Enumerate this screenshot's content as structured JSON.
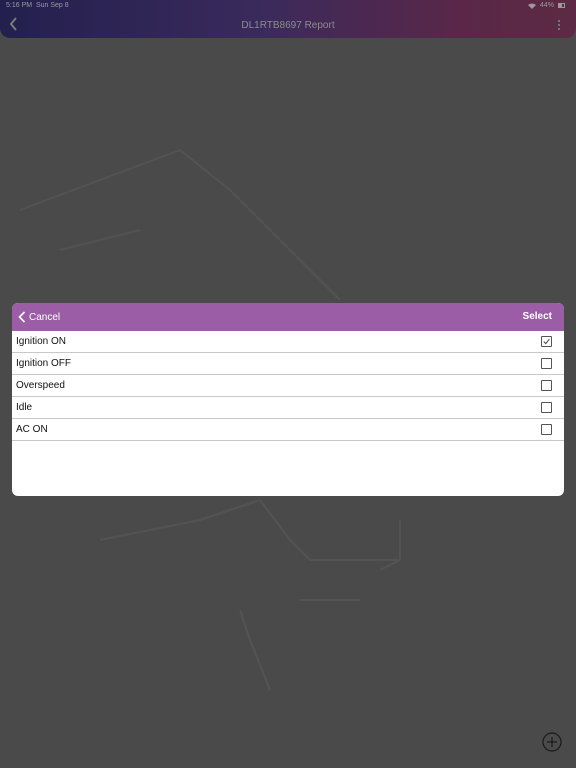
{
  "status_bar": {
    "time": "5:16 PM",
    "date": "Sun Sep 8",
    "battery": "44%"
  },
  "header": {
    "title": "DL1RTB8697 Report"
  },
  "dialog": {
    "cancel_label": "Cancel",
    "select_label": "Select",
    "items": [
      {
        "label": "Ignition ON",
        "checked": true
      },
      {
        "label": "Ignition OFF",
        "checked": false
      },
      {
        "label": "Overspeed",
        "checked": false
      },
      {
        "label": "Idle",
        "checked": false
      },
      {
        "label": "AC ON",
        "checked": false
      }
    ]
  },
  "colors": {
    "dialog_bar": "#9b5ea6",
    "overlay": "#4a4a4a"
  },
  "icons": {
    "back": "chevron-left-icon",
    "menu": "kebab-menu-icon",
    "add": "plus-circle-icon"
  }
}
